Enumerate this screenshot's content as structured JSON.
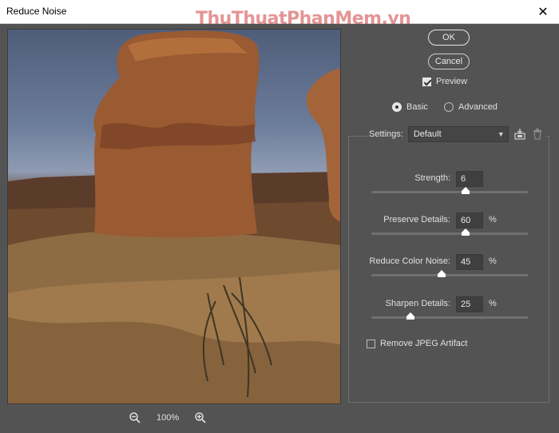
{
  "window": {
    "title": "Reduce Noise",
    "watermark": "ThuThuatPhanMem.vn",
    "close_glyph": "✕"
  },
  "buttons": {
    "ok": "OK",
    "cancel": "Cancel"
  },
  "preview_toggle": {
    "label": "Preview",
    "checked": true
  },
  "mode": {
    "options": [
      {
        "label": "Basic",
        "selected": true
      },
      {
        "label": "Advanced",
        "selected": false
      }
    ]
  },
  "settings": {
    "label": "Settings:",
    "selected": "Default",
    "icons": [
      "save-preset-icon",
      "trash-icon"
    ]
  },
  "sliders": [
    {
      "label": "Strength:",
      "value": "6",
      "unit": "",
      "level": 0.6
    },
    {
      "label": "Preserve Details:",
      "value": "60",
      "unit": "%",
      "level": 0.6
    },
    {
      "label": "Reduce Color Noise:",
      "value": "45",
      "unit": "%",
      "level": 0.45
    },
    {
      "label": "Sharpen Details:",
      "value": "25",
      "unit": "%",
      "level": 0.25
    }
  ],
  "jpeg_artifact": {
    "label": "Remove JPEG Artifact",
    "checked": false
  },
  "zoom": {
    "level": "100%",
    "icons": [
      "zoom-out-icon",
      "zoom-in-icon"
    ]
  },
  "colors": {
    "background": "#535353",
    "panel_border": "#6f6f6f",
    "watermark": "#cd3c3c"
  }
}
